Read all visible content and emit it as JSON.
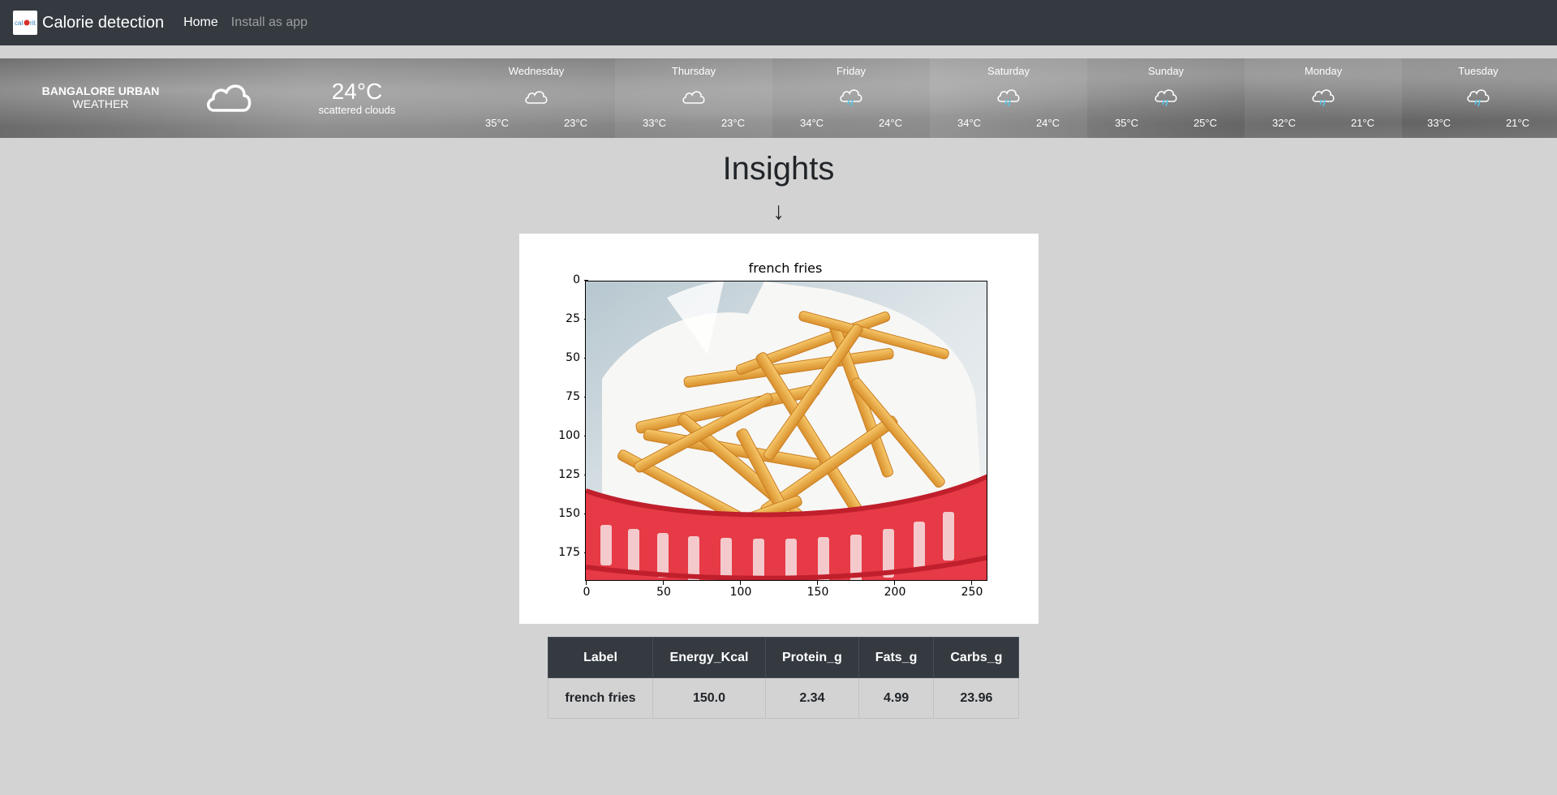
{
  "navbar": {
    "brand": "Calorie detection",
    "links": [
      {
        "label": "Home",
        "active": true
      },
      {
        "label": "Install as app",
        "active": false
      }
    ],
    "logo_text": "cal°rit"
  },
  "weather": {
    "location": "BANGALORE URBAN",
    "location_sub": "WEATHER",
    "current_icon": "cloud-icon",
    "current_temp": "24°C",
    "current_desc": "scattered clouds",
    "days": [
      {
        "name": "Wednesday",
        "icon": "cloud-icon",
        "high": "35°C",
        "low": "23°C"
      },
      {
        "name": "Thursday",
        "icon": "cloud-icon",
        "high": "33°C",
        "low": "23°C"
      },
      {
        "name": "Friday",
        "icon": "rain-cloud-icon",
        "high": "34°C",
        "low": "24°C"
      },
      {
        "name": "Saturday",
        "icon": "rain-cloud-icon",
        "high": "34°C",
        "low": "24°C"
      },
      {
        "name": "Sunday",
        "icon": "rain-cloud-icon",
        "high": "35°C",
        "low": "25°C"
      },
      {
        "name": "Monday",
        "icon": "rain-cloud-icon",
        "high": "32°C",
        "low": "21°C"
      },
      {
        "name": "Tuesday",
        "icon": "rain-cloud-icon",
        "high": "33°C",
        "low": "21°C"
      }
    ]
  },
  "insights": {
    "title": "Insights",
    "arrow": "↓"
  },
  "plot": {
    "title": "french fries",
    "y_ticks": [
      "0",
      "25",
      "50",
      "75",
      "100",
      "125",
      "150",
      "175"
    ],
    "x_ticks": [
      "0",
      "50",
      "100",
      "150",
      "200",
      "250"
    ],
    "image_label": "french fries in red basket photo"
  },
  "table": {
    "headers": [
      "Label",
      "Energy_Kcal",
      "Protein_g",
      "Fats_g",
      "Carbs_g"
    ],
    "rows": [
      [
        "french fries",
        "150.0",
        "2.34",
        "4.99",
        "23.96"
      ]
    ]
  }
}
